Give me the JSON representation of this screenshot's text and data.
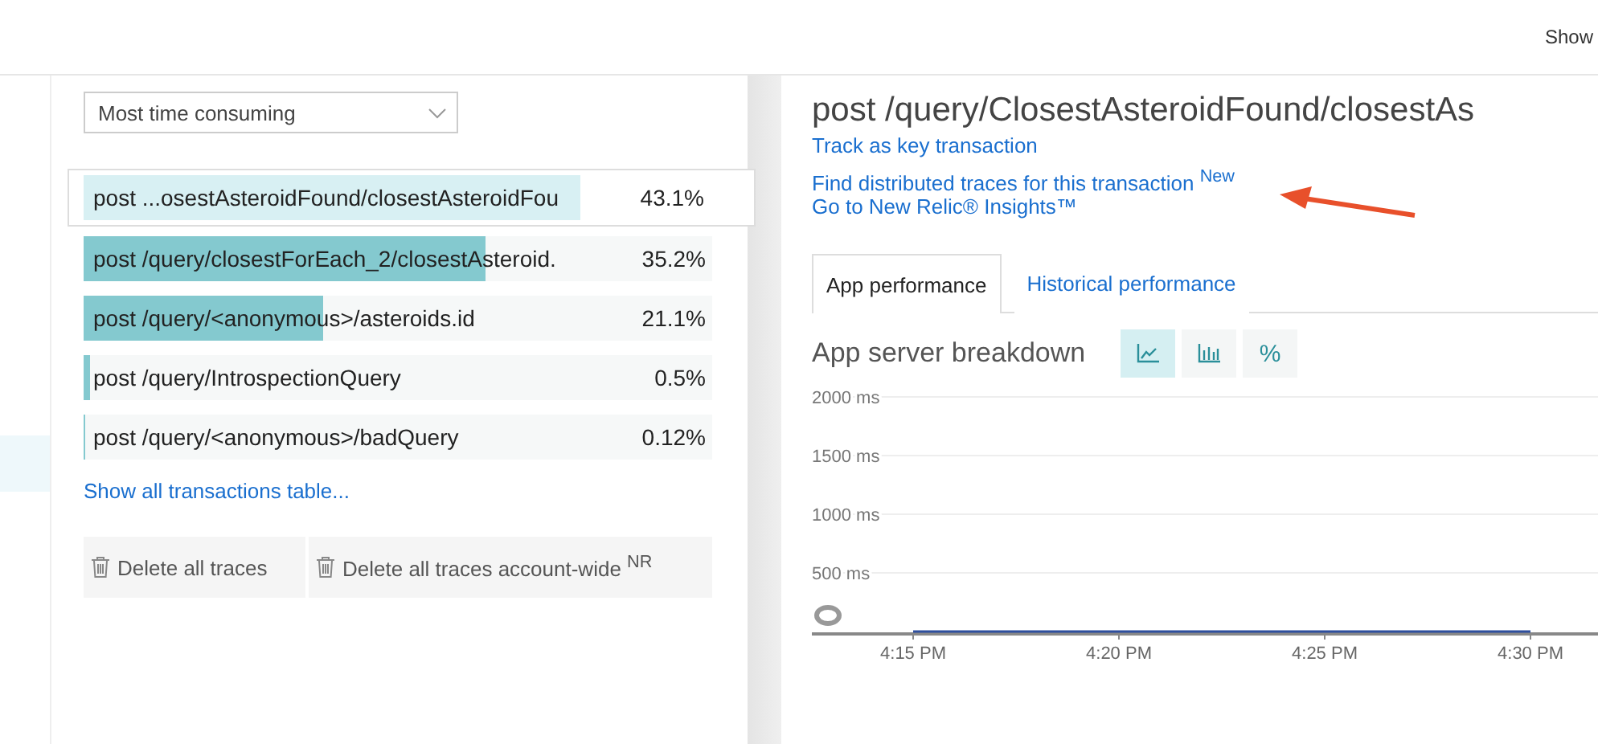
{
  "top_bar": {
    "show_label": "Show"
  },
  "sidebar": {
    "items": [
      {
        "selected": true
      }
    ]
  },
  "sort_dropdown": {
    "value": "Most time consuming"
  },
  "transactions": [
    {
      "name": "post ...osestAsteroidFound/closestAsteroidFou",
      "percent": "43.1%",
      "level": 0.79,
      "selected": true
    },
    {
      "name": "post /query/closestForEach_2/closestAsteroid.",
      "percent": "35.2%",
      "level": 0.64,
      "selected": false
    },
    {
      "name": "post /query/<anonymous>/asteroids.id",
      "percent": "21.1%",
      "level": 0.38,
      "selected": false
    },
    {
      "name": "post /query/IntrospectionQuery",
      "percent": "0.5%",
      "level": 0.01,
      "selected": false
    },
    {
      "name": "post /query/<anonymous>/badQuery",
      "percent": "0.12%",
      "level": 0.003,
      "selected": false
    }
  ],
  "show_all_link": "Show all transactions table...",
  "delete_buttons": [
    {
      "label": "Delete all traces"
    },
    {
      "label": "Delete all traces account-wide $^{NR}$"
    }
  ],
  "detail": {
    "title": "post /query/ClosestAsteroidFound/closestAs",
    "links": [
      {
        "label": "Track as key transaction"
      },
      {
        "label": "Find distributed traces for this transaction $^{New}$"
      },
      {
        "label": "Go to New Relic® Insights™"
      }
    ],
    "tabs": [
      {
        "label": "App performance",
        "selected": true
      },
      {
        "label": "Historical performance",
        "selected": false
      }
    ],
    "chart_title": "App server breakdown",
    "chart_modes": [
      {
        "kind": "area",
        "selected": true
      },
      {
        "kind": "bar",
        "selected": false
      },
      {
        "kind": "percent",
        "label": "%",
        "selected": false
      }
    ],
    "chart_data": {
      "type": "line",
      "categories": [
        "4:15 PM",
        "4:20 PM",
        "4:25 PM",
        "4:30 PM"
      ],
      "values": [
        0,
        0,
        0,
        0
      ],
      "ylim": [
        0,
        2000
      ],
      "grid": true,
      "yticks": [
        {
          "value": 500,
          "label": "500 ms"
        },
        {
          "value": 1000,
          "label": "1000 ms"
        },
        {
          "value": 1500,
          "label": "1500 ms"
        },
        {
          "value": 2000,
          "label": "2000 ms"
        }
      ]
    }
  }
}
